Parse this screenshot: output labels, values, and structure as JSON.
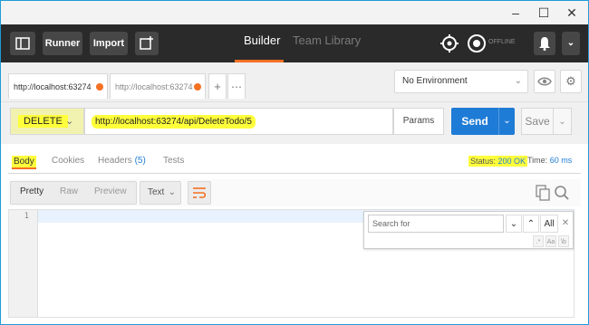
{
  "toolbar": {
    "runner": "Runner",
    "import": "Import",
    "builder": "Builder",
    "team_library": "Team Library",
    "offline": "OFFLINE"
  },
  "request_tabs": [
    {
      "label": "http://localhost:63274"
    },
    {
      "label": "http://localhost:63274"
    }
  ],
  "environment": {
    "selected": "No Environment"
  },
  "request": {
    "method": "DELETE",
    "url": "http://localhost:63274/api/DeleteTodo/5",
    "params": "Params",
    "send": "Send",
    "save": "Save"
  },
  "response": {
    "tabs": {
      "body": "Body",
      "cookies": "Cookies",
      "headers": "Headers",
      "headers_count": "(5)",
      "tests": "Tests"
    },
    "status_label": "Status:",
    "status_value": "200 OK",
    "time_label": "Time:",
    "time_value": "60 ms",
    "format": {
      "pretty": "Pretty",
      "raw": "Raw",
      "preview": "Preview",
      "type": "Text"
    },
    "line_number": "1"
  },
  "search": {
    "placeholder": "Search for",
    "all": "All",
    "opt_regex": ".*",
    "opt_case": "Aa",
    "opt_word": "\\b"
  },
  "colors": {
    "accent": "#f47023",
    "send": "#1f7cd6",
    "highlight": "#ffff3b",
    "window_border": "#1f9bd7"
  }
}
